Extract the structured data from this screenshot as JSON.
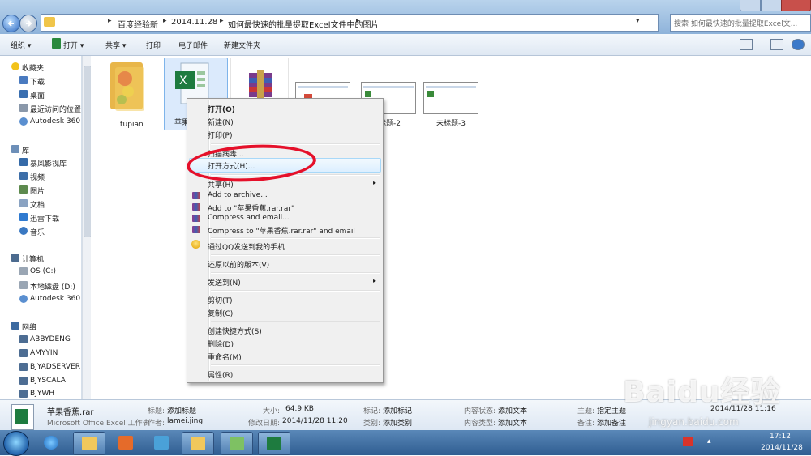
{
  "address": {
    "crumbs": [
      "百度经验新",
      "2014.11.28",
      "如何最快速的批量提取Excel文件中的图片"
    ],
    "search_placeholder": "搜索 如何最快速的批量提取Excel文..."
  },
  "toolbar": {
    "organize": "组织 ▾",
    "open": "打开 ▾",
    "share": "共享 ▾",
    "print": "打印",
    "email": "电子邮件",
    "new_folder": "新建文件夹"
  },
  "sidebar": {
    "favorites": "收藏夹",
    "fav_items": [
      "下载",
      "桌面",
      "最近访问的位置",
      "Autodesk 360"
    ],
    "library": "库",
    "lib_items": [
      "暴风影视库",
      "视频",
      "图片",
      "文档",
      "迅雷下载",
      "音乐"
    ],
    "computer": "计算机",
    "comp_items": [
      "OS (C:)",
      "本地磁盘 (D:)",
      "Autodesk 360"
    ],
    "network": "网络",
    "net_items": [
      "ABBYDENG",
      "AMYYIN",
      "BJYADSERVER",
      "BJYSCALA",
      "BJYWH"
    ]
  },
  "files": {
    "folder": "tupian",
    "excel": "苹果",
    "thumb2": "标题-2",
    "thumb3": "未标题-3"
  },
  "menu": {
    "open": "打开(O)",
    "new": "新建(N)",
    "print": "打印(P)",
    "scan": "扫描病毒...",
    "open_with": "打开方式(H)...",
    "share": "共享(H)",
    "rar1": "Add to archive...",
    "rar2": "Add to \"苹果香蕉.rar.rar\"",
    "rar3": "Compress and email...",
    "rar4": "Compress to \"苹果香蕉.rar.rar\" and email",
    "qq": "通过QQ发送到我的手机",
    "restore": "还原以前的版本(V)",
    "sendto": "发送到(N)",
    "cut": "剪切(T)",
    "copy": "复制(C)",
    "shortcut": "创建快捷方式(S)",
    "delete": "删除(D)",
    "rename": "重命名(M)",
    "properties": "属性(R)"
  },
  "details": {
    "filename": "苹果香蕉.rar",
    "filetype": "Microsoft Office Excel 工作表",
    "k_title": "标题:",
    "v_title": "添加标题",
    "k_author": "作者:",
    "v_author": "lamei.jing",
    "k_size": "大小:",
    "v_size": "64.9 KB",
    "k_modified": "修改日期:",
    "v_modified": "2014/11/28 11:20",
    "k_tags": "标记:",
    "v_tags": "添加标记",
    "k_category": "类别:",
    "v_category": "添加类别",
    "k_status": "内容状态:",
    "v_status": "添加文本",
    "k_ctype": "内容类型:",
    "v_ctype": "添加文本",
    "k_subject": "主题:",
    "v_subject": "指定主题",
    "k_notes": "备注:",
    "v_notes": "添加备注",
    "v_created": "2014/11/28 11:16"
  },
  "taskbar": {
    "time": "17:12",
    "date": "2014/11/28"
  },
  "watermark": {
    "logo": "Baidu经验",
    "url": "jingyan.baidu.com"
  }
}
